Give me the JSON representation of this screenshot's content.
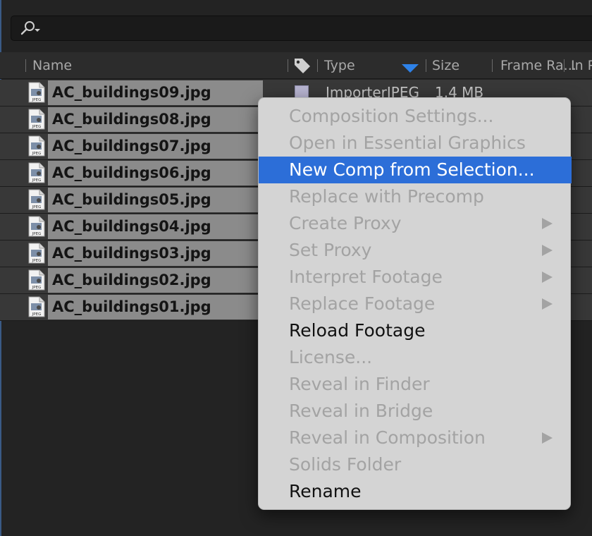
{
  "search": {
    "icon": "search-icon"
  },
  "columns": {
    "name": "Name",
    "label_icon": "tag-icon",
    "type": "Type",
    "size": "Size",
    "frame_rate": "Frame Ra...",
    "in_point": "In P"
  },
  "files": [
    {
      "name": "AC_buildings09.jpg",
      "type": "ImporterJPEG",
      "size": "1.4 MB"
    },
    {
      "name": "AC_buildings08.jpg"
    },
    {
      "name": "AC_buildings07.jpg"
    },
    {
      "name": "AC_buildings06.jpg"
    },
    {
      "name": "AC_buildings05.jpg"
    },
    {
      "name": "AC_buildings04.jpg"
    },
    {
      "name": "AC_buildings03.jpg"
    },
    {
      "name": "AC_buildings02.jpg"
    },
    {
      "name": "AC_buildings01.jpg"
    }
  ],
  "file_icon_text": "JPEG",
  "context_menu": {
    "items": [
      {
        "label": "Composition Settings...",
        "enabled": false
      },
      {
        "label": "Open in Essential Graphics",
        "enabled": false
      },
      {
        "label": "New Comp from Selection...",
        "enabled": true,
        "highlighted": true
      },
      {
        "label": "Replace with Precomp",
        "enabled": false
      },
      {
        "label": "Create Proxy",
        "enabled": false,
        "submenu": true
      },
      {
        "label": "Set Proxy",
        "enabled": false,
        "submenu": true
      },
      {
        "label": "Interpret Footage",
        "enabled": false,
        "submenu": true
      },
      {
        "label": "Replace Footage",
        "enabled": false,
        "submenu": true
      },
      {
        "label": "Reload Footage",
        "enabled": true
      },
      {
        "label": "License...",
        "enabled": false
      },
      {
        "label": "Reveal in Finder",
        "enabled": false
      },
      {
        "label": "Reveal in Bridge",
        "enabled": false
      },
      {
        "label": "Reveal in Composition",
        "enabled": false,
        "submenu": true
      },
      {
        "label": "Solids Folder",
        "enabled": false
      },
      {
        "label": "Rename",
        "enabled": true
      }
    ]
  },
  "colors": {
    "highlight": "#2c6ed8",
    "selection": "#8b8b8b",
    "label_swatch": "#b6b3cf"
  }
}
